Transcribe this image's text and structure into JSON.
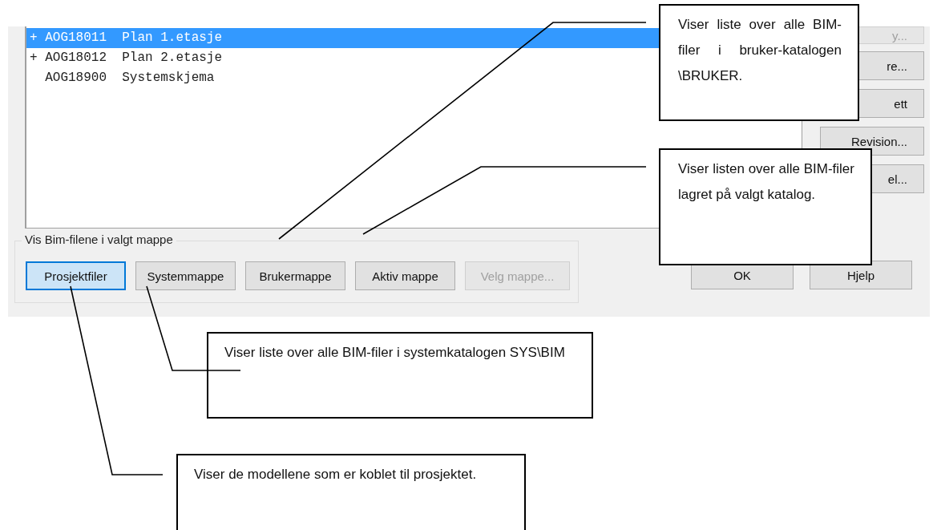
{
  "file_list": {
    "rows": [
      {
        "marker": "+",
        "code": "AOG18011",
        "name": "Plan 1.etasje",
        "selected": true
      },
      {
        "marker": "+",
        "code": "AOG18012",
        "name": "Plan 2.etasje",
        "selected": false
      },
      {
        "code": "AOG18900",
        "name": "Systemskjema",
        "selected": false
      }
    ]
  },
  "side_buttons": [
    {
      "label": "y...",
      "disabled": true
    },
    {
      "label": "re...",
      "disabled": false
    },
    {
      "label": "ett",
      "disabled": false
    },
    {
      "label": "Revision...",
      "disabled": false
    },
    {
      "label": "el...",
      "disabled": false
    }
  ],
  "folder_group": {
    "title": "Vis Bim-filene i valgt mappe",
    "buttons": [
      {
        "label": "Prosjektfiler",
        "selected": true,
        "disabled": false
      },
      {
        "label": "Systemmappe",
        "selected": false,
        "disabled": false
      },
      {
        "label": "Brukermappe",
        "selected": false,
        "disabled": false
      },
      {
        "label": "Aktiv mappe",
        "selected": false,
        "disabled": false
      },
      {
        "label": "Velg mappe...",
        "selected": false,
        "disabled": true
      }
    ]
  },
  "dialog_buttons": [
    "OK",
    "Hjelp"
  ],
  "callouts": [
    {
      "text": "Viser liste over alle BIM-filer i bruker-katalogen \\BRUKER."
    },
    {
      "text": "Viser listen over alle BIM-filer lagret på valgt katalog."
    },
    {
      "text": "Viser liste over alle BIM-filer i systemkatalogen SYS\\BIM"
    },
    {
      "text": "Viser de modellene som er koblet til prosjektet."
    }
  ]
}
